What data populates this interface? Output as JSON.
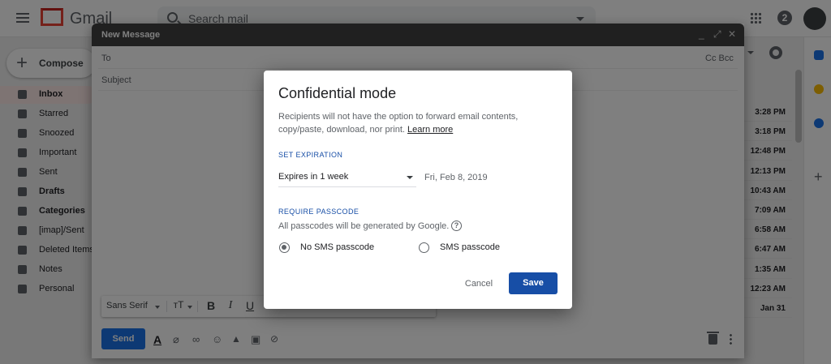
{
  "app": {
    "logo_text": "Gmail"
  },
  "search": {
    "placeholder": "Search mail"
  },
  "header": {
    "help_label": "2"
  },
  "nav": {
    "compose_label": "Compose",
    "items": [
      {
        "label": "Inbox",
        "icon": "inbox-icon",
        "active": true,
        "bold": true
      },
      {
        "label": "Starred",
        "icon": "star-icon"
      },
      {
        "label": "Snoozed",
        "icon": "clock-icon"
      },
      {
        "label": "Important",
        "icon": "important-icon"
      },
      {
        "label": "Sent",
        "icon": "send-icon"
      },
      {
        "label": "Drafts",
        "icon": "draft-icon",
        "bold": true
      },
      {
        "label": "Categories",
        "icon": "label-icon",
        "bold": true
      },
      {
        "label": "[imap]/Sent",
        "icon": "label-icon"
      },
      {
        "label": "Deleted Items",
        "icon": "label-icon"
      },
      {
        "label": "Notes",
        "icon": "label-icon"
      },
      {
        "label": "Personal",
        "icon": "label-icon"
      }
    ]
  },
  "mail_times": [
    "3:28 PM",
    "3:18 PM",
    "12:48 PM",
    "12:13 PM",
    "10:43 AM",
    "7:09 AM",
    "6:58 AM",
    "6:47 AM",
    "1:35 AM",
    "12:23 AM",
    "Jan 31"
  ],
  "compose": {
    "title": "New Message",
    "to_label": "To",
    "cc_bcc_label": "Cc Bcc",
    "subject_label": "Subject",
    "font_family": "Sans Serif",
    "send_label": "Send"
  },
  "dialog": {
    "title": "Confidential mode",
    "description": "Recipients will not have the option to forward email contents, copy/paste, download, nor print.",
    "learn_more": "Learn more",
    "expiration_heading": "SET EXPIRATION",
    "expiration_value": "Expires in 1 week",
    "expiration_date": "Fri, Feb 8, 2019",
    "passcode_heading": "REQUIRE PASSCODE",
    "passcode_note": "All passcodes will be generated by Google.",
    "help_glyph": "?",
    "radio_no_sms": "No SMS passcode",
    "radio_sms": "SMS passcode",
    "cancel_label": "Cancel",
    "save_label": "Save"
  },
  "colors": {
    "accent_blue": "#174ea6",
    "send_blue": "#1a73e8",
    "compose_header": "#404040"
  }
}
